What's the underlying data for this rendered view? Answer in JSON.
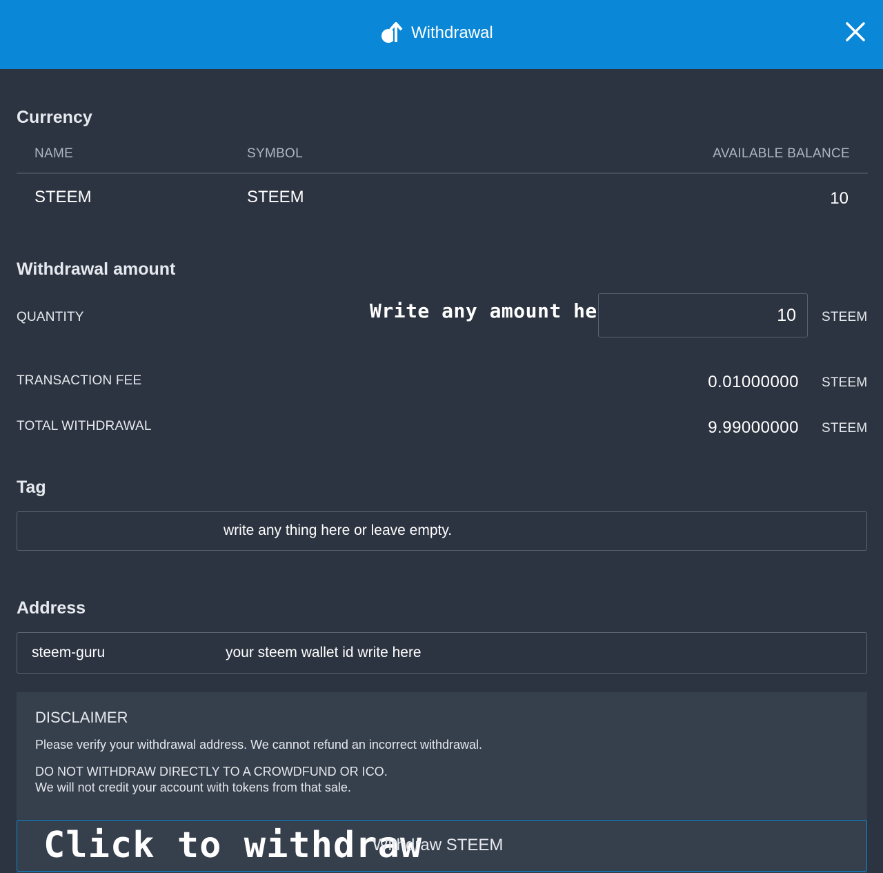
{
  "header": {
    "title": "Withdrawal",
    "icon": "withdrawal-arrow-icon",
    "close_icon": "close-icon",
    "background": "#0a87d6"
  },
  "currency": {
    "section_title": "Currency",
    "columns": [
      "NAME",
      "SYMBOL",
      "AVAILABLE BALANCE"
    ],
    "row": {
      "name": "STEEM",
      "symbol": "STEEM",
      "available_balance": "10"
    }
  },
  "withdrawal_amount": {
    "section_title": "Withdrawal amount",
    "quantity_label": "QUANTITY",
    "quantity_hint": "Write any amount here",
    "quantity_value": "10",
    "quantity_unit": "STEEM",
    "fee_label": "TRANSACTION FEE",
    "fee_value": "0.01000000",
    "fee_unit": "STEEM",
    "total_label": "TOTAL WITHDRAWAL",
    "total_value": "9.99000000",
    "total_unit": "STEEM"
  },
  "tag": {
    "section_title": "Tag",
    "note": "write any thing here or leave empty."
  },
  "address": {
    "section_title": "Address",
    "value": "steem-guru",
    "note": "your steem wallet id write here"
  },
  "disclaimer": {
    "title": "DISCLAIMER",
    "line1": "Please verify your withdrawal address. We cannot refund an incorrect withdrawal.",
    "line2": "DO NOT WITHDRAW DIRECTLY TO A CROWDFUND OR ICO.",
    "line3": "We will not credit your account with tokens from that sale."
  },
  "submit": {
    "hint": "Click to withdraw",
    "label": "Withdraw STEEM"
  }
}
